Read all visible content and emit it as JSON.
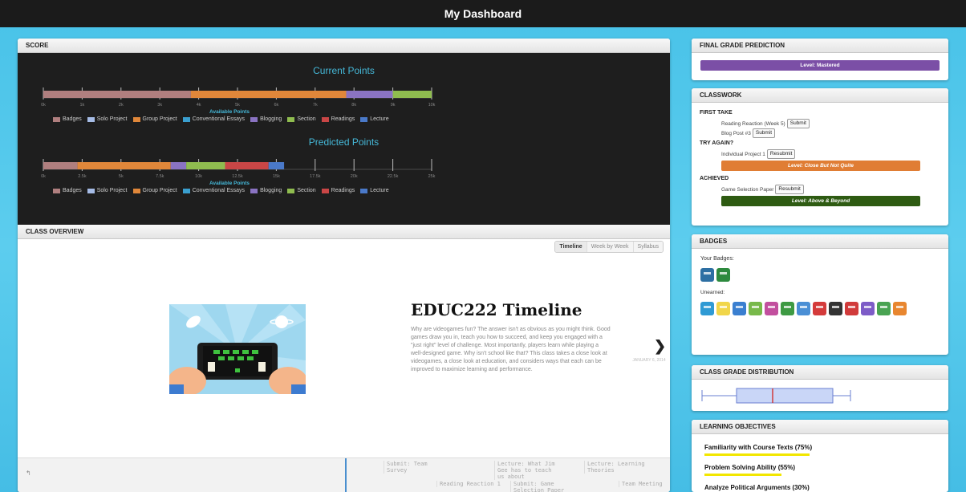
{
  "header": {
    "title": "My Dashboard"
  },
  "score": {
    "title": "SCORE",
    "current_points_title": "Current Points",
    "predicted_points_title": "Predicted Points",
    "axis_label": "Available Points",
    "current_ticks": [
      "0k",
      "1k",
      "2k",
      "3k",
      "4k",
      "5k",
      "6k",
      "7k",
      "8k",
      "9k",
      "10k"
    ],
    "predicted_ticks": [
      "0k",
      "2.5k",
      "5k",
      "7.5k",
      "10k",
      "12.5k",
      "15k",
      "17.5k",
      "20k",
      "22.5k",
      "25k"
    ],
    "legend": [
      {
        "label": "Badges",
        "color": "#b07f7f"
      },
      {
        "label": "Solo Project",
        "color": "#a6bce6"
      },
      {
        "label": "Group Project",
        "color": "#e0873a"
      },
      {
        "label": "Conventional Essays",
        "color": "#3a9fcf"
      },
      {
        "label": "Blogging",
        "color": "#8a73c2"
      },
      {
        "label": "Section",
        "color": "#8fbc4f"
      },
      {
        "label": "Readings",
        "color": "#c94646"
      },
      {
        "label": "Lecture",
        "color": "#4a79c9"
      }
    ]
  },
  "chart_data": [
    {
      "type": "bar",
      "title": "Current Points",
      "xlabel": "Available Points",
      "xlim": [
        0,
        10000
      ],
      "series": [
        {
          "name": "Badges",
          "values": [
            3800
          ]
        },
        {
          "name": "Group Project",
          "values": [
            4000
          ]
        },
        {
          "name": "Blogging",
          "values": [
            1200
          ]
        },
        {
          "name": "Section",
          "values": [
            1000
          ]
        }
      ]
    },
    {
      "type": "bar",
      "title": "Predicted Points",
      "xlabel": "Available Points",
      "xlim": [
        0,
        25000
      ],
      "series": [
        {
          "name": "Badges",
          "values": [
            2200
          ]
        },
        {
          "name": "Group Project",
          "values": [
            6000
          ]
        },
        {
          "name": "Blogging",
          "values": [
            1000
          ]
        },
        {
          "name": "Section",
          "values": [
            2500
          ]
        },
        {
          "name": "Readings",
          "values": [
            2800
          ]
        },
        {
          "name": "Lecture",
          "values": [
            1000
          ]
        }
      ]
    }
  ],
  "overview": {
    "title": "CLASS OVERVIEW",
    "tabs": [
      "Timeline",
      "Week by Week",
      "Syllabus"
    ],
    "timeline_title": "EDUC222 Timeline",
    "timeline_text": "Why are videogames fun? The answer isn't as obvious as you might think. Good games draw you in, teach you how to succeed, and keep you engaged with a \"just right\" level of challenge. Most importantly, players learn while playing a well-designed game. Why isn't school like that? This class takes a close look at videogames, a close look at education, and considers ways that each can be improved to maximize learning and performance.",
    "date_text": "JANUARY 6, 2014",
    "next_icon": "chevron-right-icon",
    "strip": [
      {
        "label": "Submit: Team Survey"
      },
      {
        "label": "Lecture: What Jim Gee has to teach us about"
      },
      {
        "label": "Lecture: Learning Theories"
      },
      {
        "label": "Reading Reaction 1"
      },
      {
        "label": "Submit: Game Selection Paper"
      },
      {
        "label": "Team Meeting"
      }
    ]
  },
  "final_grade": {
    "title": "FINAL GRADE PREDICTION",
    "level": "Level: Mastered",
    "color": "#7b4fa6"
  },
  "classwork": {
    "title": "CLASSWORK",
    "first_take": "FIRST TAKE",
    "items_first": [
      {
        "label": "Reading Reaction (Week 5)",
        "button": "Submit"
      },
      {
        "label": "Blog Post #3",
        "button": "Submit"
      }
    ],
    "try_again": "TRY AGAIN?",
    "items_try": [
      {
        "label": "Individual Project 1",
        "button": "Resubmit"
      }
    ],
    "try_level": "Level: Close But Not Quite",
    "try_color": "#e07d34",
    "achieved": "ACHIEVED",
    "items_achieved": [
      {
        "label": "Game Selection Paper",
        "button": "Resubmit"
      }
    ],
    "achieved_level": "Level: Above & Beyond",
    "achieved_color": "#2e5b12"
  },
  "badges": {
    "title": "BADGES",
    "your_badges": "Your Badges:",
    "unearned": "Unearned:",
    "earned_colors": [
      "#2d6fa3",
      "#2d8a3e"
    ],
    "unearned_colors": [
      "#2f9ad4",
      "#f1d64a",
      "#3a7fd0",
      "#78b94a",
      "#c24f9e",
      "#3e9a43",
      "#4a8fd5",
      "#d43b3b",
      "#333333",
      "#d13b3b",
      "#7d5cc7",
      "#49a352",
      "#e8862f"
    ]
  },
  "distribution": {
    "title": "CLASS GRADE DISTRIBUTION"
  },
  "objectives": {
    "title": "LEARNING OBJECTIVES",
    "items": [
      {
        "label": "Familiarity with Course Texts (75%)",
        "value": 75
      },
      {
        "label": "Problem Solving Ability (55%)",
        "value": 55
      },
      {
        "label": "Analyze Political Arguments (30%)",
        "value": 30
      }
    ]
  }
}
